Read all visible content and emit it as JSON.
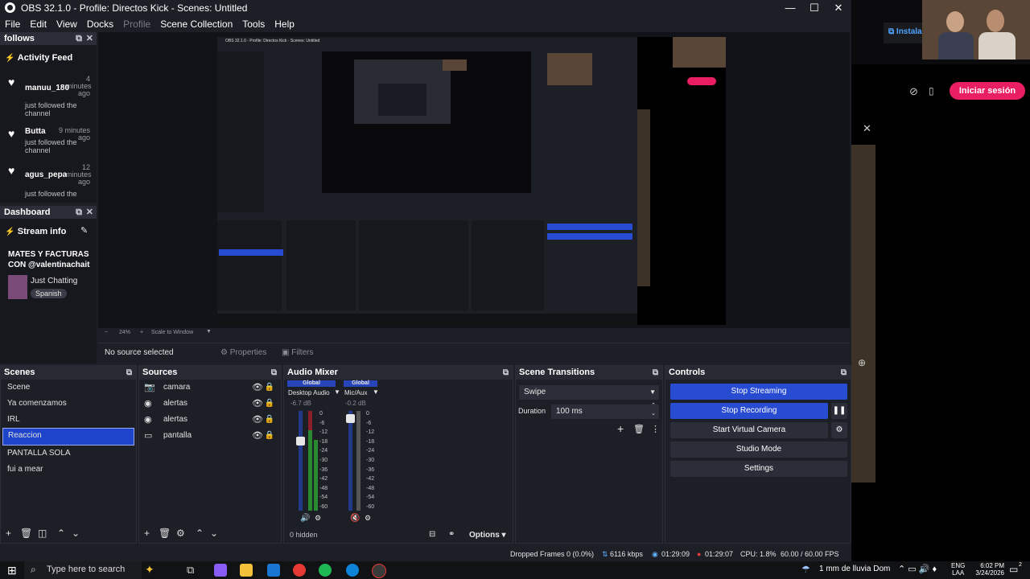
{
  "window": {
    "title": "OBS 32.1.0 - Profile: Directos Kick - Scenes: Untitled",
    "minimize": "—",
    "maximize": "☐",
    "close": "✕"
  },
  "menu": [
    "File",
    "Edit",
    "View",
    "Docks",
    "Profile",
    "Scene Collection",
    "Tools",
    "Help"
  ],
  "follows_dock": {
    "title": "follows",
    "activity_title": "Activity Feed",
    "items": [
      {
        "name": "manuu_180",
        "time": "4 minutes ago",
        "text": "just followed the channel"
      },
      {
        "name": "Butta",
        "time": "9 minutes ago",
        "text": "just followed the channel"
      },
      {
        "name": "agus_pepa",
        "time": "12 minutes ago",
        "text": "just followed the"
      }
    ]
  },
  "dashboard_dock": {
    "title": "Dashboard",
    "stream_info": "Stream info",
    "stream_title": "MATES Y FACTURAS CON @valentinachait",
    "category": "Just Chatting",
    "language": "Spanish"
  },
  "preview": {
    "zoom": "24%",
    "scale": "Scale to Window",
    "nested_title": "OBS 32.1.0 - Profile: Directos Kick - Scenes: Untitled",
    "iniciar_sesion": "Iniciar sesión",
    "instala": "Instala"
  },
  "properties_bar": {
    "no_source": "No source selected",
    "properties": "Properties",
    "filters": "Filters"
  },
  "scenes": {
    "title": "Scenes",
    "items": [
      "Scene",
      "Ya comenzamos",
      "IRL",
      "Reaccion",
      "PANTALLA SOLA",
      "fui a mear"
    ],
    "selected": "Reaccion"
  },
  "sources": {
    "title": "Sources",
    "items": [
      {
        "name": "camara",
        "icon": "camera-icon"
      },
      {
        "name": "alertas",
        "icon": "globe-icon"
      },
      {
        "name": "alertas",
        "icon": "globe-icon"
      },
      {
        "name": "pantalla",
        "icon": "monitor-icon"
      }
    ]
  },
  "audio_mixer": {
    "title": "Audio Mixer",
    "channels": [
      {
        "tag": "Global",
        "name": "Desktop Audio",
        "level": "-6.7 dB"
      },
      {
        "tag": "Global",
        "name": "Mic/Aux",
        "level": "-0.2 dB"
      }
    ],
    "scale": [
      "0",
      "-6",
      "-12",
      "-18",
      "-24",
      "-30",
      "-36",
      "-42",
      "-48",
      "-54",
      "-60"
    ],
    "hidden": "0 hidden",
    "options": "Options"
  },
  "scene_transitions": {
    "title": "Scene Transitions",
    "transition": "Swipe",
    "duration_label": "Duration",
    "duration_value": "100 ms"
  },
  "controls": {
    "title": "Controls",
    "stop_streaming": "Stop Streaming",
    "stop_recording": "Stop Recording",
    "start_virtual_camera": "Start Virtual Camera",
    "studio_mode": "Studio Mode",
    "settings": "Settings"
  },
  "status": {
    "dropped": "Dropped Frames 0 (0.0%)",
    "bitrate": "6116 kbps",
    "stream_time": "01:29:09",
    "rec_time": "01:29:07",
    "cpu": "CPU: 1.8%",
    "fps": "60.00 / 60.00 FPS"
  },
  "taskbar": {
    "search_placeholder": "Type here to search",
    "weather": "1 mm de lluvia Dom",
    "lang1": "ENG",
    "lang2": "LAA",
    "time": "6:02 PM",
    "date": "3/24/2026",
    "notif_count": "2"
  },
  "colors": {
    "accent_blue": "#284cd1",
    "kick_pink": "#e91e63",
    "dock_bg": "#1d1f26"
  }
}
